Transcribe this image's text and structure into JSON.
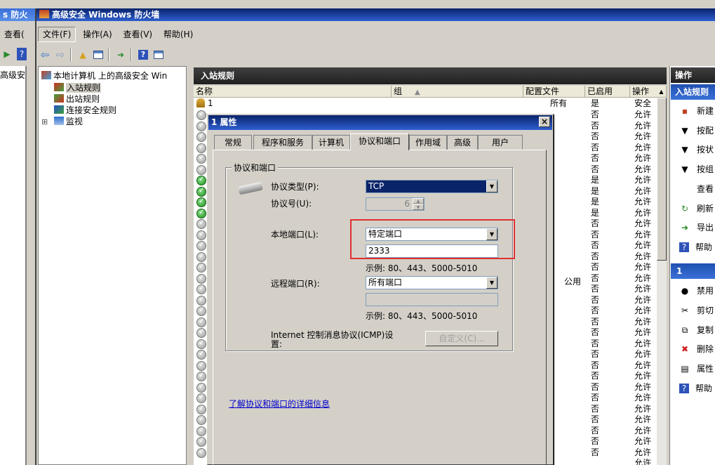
{
  "back_window": {
    "title": "s 防火",
    "menu_view": "查看(",
    "tree_root": "高级安"
  },
  "main_window": {
    "title": "高级安全 Windows 防火墙",
    "menu": [
      "文件(F)",
      "操作(A)",
      "查看(V)",
      "帮助(H)"
    ]
  },
  "tree": {
    "root": "本地计算机 上的高级安全 Win",
    "items": [
      {
        "label": "入站规则",
        "icon": "inbound-rules-icon"
      },
      {
        "label": "出站规则",
        "icon": "outbound-rules-icon"
      },
      {
        "label": "连接安全规则",
        "icon": "connection-security-icon"
      },
      {
        "label": "监视",
        "icon": "monitor-icon",
        "expander": "⊞"
      }
    ]
  },
  "list": {
    "header_title": "入站规则",
    "columns": [
      "名称",
      "组",
      "配置文件",
      "已启用",
      "操作"
    ],
    "first_row": {
      "name": "1",
      "profile": "所有",
      "enabled": "是",
      "action": "安全"
    },
    "public_label": "公用",
    "enabled_values": [
      "否",
      "否",
      "否",
      "否",
      "否",
      "否",
      "是",
      "是",
      "是",
      "是",
      "否",
      "否",
      "否",
      "否",
      "否",
      "否",
      "否",
      "否",
      "否",
      "否",
      "否",
      "否",
      "否",
      "否",
      "否",
      "否",
      "否",
      "否",
      "否",
      "否",
      "否",
      "否"
    ],
    "action_values": [
      "允许",
      "允许",
      "允许",
      "允许",
      "允许",
      "允许",
      "允许",
      "允许",
      "允许",
      "允许",
      "允许",
      "允许",
      "允许",
      "允许",
      "允许",
      "允许",
      "允许",
      "允许",
      "允许",
      "允许",
      "允许",
      "允许",
      "允许",
      "允许",
      "允许",
      "允许",
      "允许",
      "允许",
      "允许",
      "允许",
      "允许",
      "允许",
      "允许"
    ]
  },
  "actions_panel": {
    "header": "操作",
    "section1": "入站规则",
    "items1": [
      "新建",
      "按配",
      "按状",
      "按组",
      "查看",
      "刷新",
      "导出",
      "帮助"
    ],
    "section2": "1",
    "items2": [
      "禁用",
      "剪切",
      "复制",
      "删除",
      "属性",
      "帮助"
    ]
  },
  "dialog": {
    "title": "1 属性",
    "close": "×",
    "tabs": [
      "常规",
      "程序和服务",
      "计算机",
      "协议和端口",
      "作用域",
      "高级",
      "用户"
    ],
    "group_title": "协议和端口",
    "protocol_type_label": "协议类型(P):",
    "protocol_type_value": "TCP",
    "protocol_number_label": "协议号(U):",
    "protocol_number_value": "6",
    "local_port_label": "本地端口(L):",
    "local_port_value": "特定端口",
    "local_port_input": "2333",
    "example1": "示例: 80、443、5000-5010",
    "remote_port_label": "远程端口(R):",
    "remote_port_value": "所有端口",
    "remote_port_input": "",
    "example2": "示例: 80、443、5000-5010",
    "icmp_label_line1": "Internet 控制消息协议(ICMP)设",
    "icmp_label_line2": "置:",
    "customize_button": "自定义(C)...",
    "learn_more_link": "了解协议和端口的详细信息"
  },
  "colors": {
    "highlight_box": "#e03030",
    "title_gradient_start": "#0a246a",
    "title_gradient_end": "#2e5fd0",
    "link": "#0000cc"
  }
}
